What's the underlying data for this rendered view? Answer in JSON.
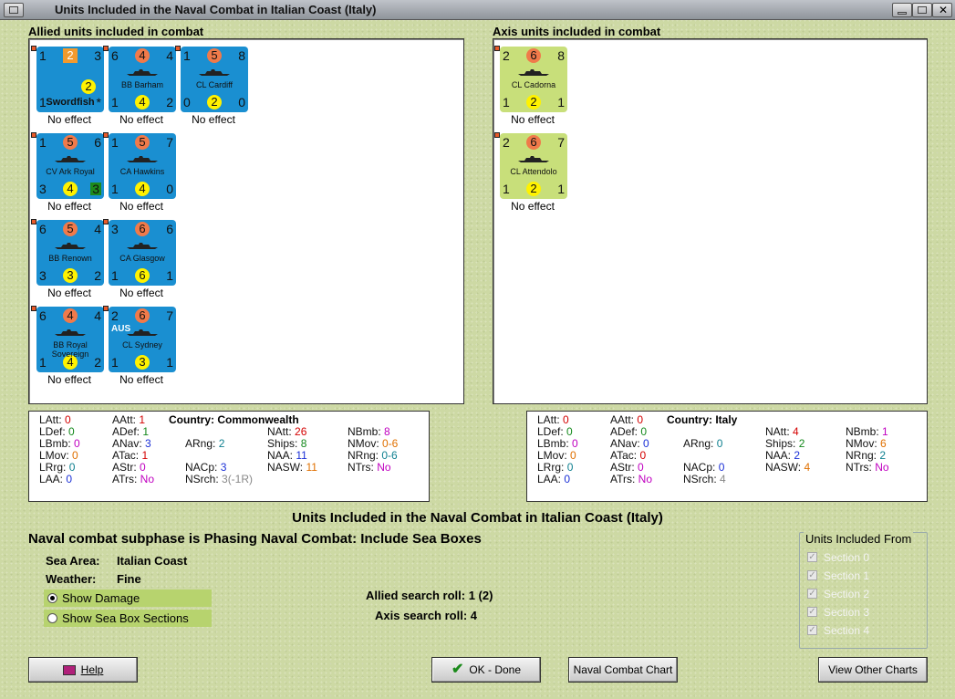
{
  "window": {
    "title": "Units Included in the Naval Combat in Italian Coast (Italy)"
  },
  "allied": {
    "header": "Allied units included in combat"
  },
  "axis": {
    "header": "Axis units included in combat"
  },
  "units_allied": [
    {
      "tl": "1",
      "tr": "3",
      "orange": "2",
      "bl": "1",
      "br": "*",
      "yellow": "2",
      "name": "Swordfish",
      "status": "No effect"
    },
    {
      "tl": "6",
      "tr": "4",
      "orange": "4",
      "bl": "1",
      "br": "2",
      "yellow": "4",
      "name": "BB Barham",
      "status": "No effect"
    },
    {
      "tl": "1",
      "tr": "8",
      "orange": "5",
      "bl": "0",
      "br": "0",
      "yellow": "2",
      "name": "CL Cardiff",
      "status": "No effect"
    },
    {
      "tl": "1",
      "tr": "6",
      "orange": "5",
      "bl": "3",
      "br": "3",
      "yellow": "4",
      "name": "CV Ark Royal",
      "status": "No effect"
    },
    {
      "tl": "1",
      "tr": "7",
      "orange": "5",
      "bl": "1",
      "br": "0",
      "yellow": "4",
      "name": "CA Hawkins",
      "status": "No effect"
    },
    {
      "tl": "6",
      "tr": "4",
      "orange": "5",
      "bl": "3",
      "br": "2",
      "yellow": "3",
      "name": "BB Renown",
      "status": "No effect"
    },
    {
      "tl": "3",
      "tr": "6",
      "orange": "6",
      "bl": "1",
      "br": "1",
      "yellow": "6",
      "name": "CA Glasgow",
      "status": "No effect"
    },
    {
      "tl": "6",
      "tr": "4",
      "orange": "4",
      "bl": "1",
      "br": "2",
      "yellow": "4",
      "name": "BB Royal Sovereign",
      "status": "No effect"
    },
    {
      "tl": "2",
      "tr": "7",
      "orange": "6",
      "bl": "1",
      "br": "1",
      "yellow": "3",
      "name": "CL Sydney",
      "status": "No effect",
      "tag": "AUS"
    }
  ],
  "units_axis": [
    {
      "tl": "2",
      "tr": "8",
      "orange": "6",
      "bl": "1",
      "br": "1",
      "yellow": "2",
      "name": "CL Cadorna",
      "status": "No effect"
    },
    {
      "tl": "2",
      "tr": "7",
      "orange": "6",
      "bl": "1",
      "br": "1",
      "yellow": "2",
      "name": "CL Attendolo",
      "status": "No effect"
    }
  ],
  "stats_allied": {
    "country_label": "Country: Commonwealth",
    "LAtt": "0",
    "LDef": "0",
    "LBmb": "0",
    "LMov": "0",
    "LRrg": "0",
    "LAA": "0",
    "AAtt": "1",
    "ADef": "1",
    "ANav": "3",
    "ATac": "1",
    "AStr": "0",
    "ATrs": "No",
    "ARng": "2",
    "NACp": "3",
    "NSrch": "3(-1R)",
    "NAtt": "26",
    "Ships": "8",
    "NAA": "11",
    "NASW": "11",
    "NBmb": "8",
    "NMov": "0-6",
    "NRng": "0-6",
    "NTrs": "No"
  },
  "stats_axis": {
    "country_label": "Country: Italy",
    "LAtt": "0",
    "LDef": "0",
    "LBmb": "0",
    "LMov": "0",
    "LRrg": "0",
    "LAA": "0",
    "AAtt": "0",
    "ADef": "0",
    "ANav": "0",
    "ATac": "0",
    "AStr": "0",
    "ATrs": "No",
    "ARng": "0",
    "NACp": "0",
    "NSrch": "4",
    "NAtt": "4",
    "Ships": "2",
    "NAA": "2",
    "NASW": "4",
    "NBmb": "1",
    "NMov": "6",
    "NRng": "2",
    "NTrs": "No"
  },
  "summary": {
    "title": "Units Included in the Naval Combat in Italian Coast (Italy)",
    "subphase": "Naval combat subphase is Phasing Naval Combat: Include Sea Boxes",
    "sea_area_label": "Sea Area:",
    "sea_area": "Italian Coast",
    "weather_label": "Weather:",
    "weather": "Fine",
    "allied_roll": "Allied search roll: 1 (2)",
    "axis_roll": "Axis search roll: 4"
  },
  "options": {
    "show_damage": "Show Damage",
    "show_sections": "Show Sea Box Sections"
  },
  "sections": {
    "legend": "Units Included From",
    "items": [
      "Section 0",
      "Section 1",
      "Section 2",
      "Section 3",
      "Section 4"
    ]
  },
  "buttons": {
    "help": "Help",
    "ok": "OK - Done",
    "naval_chart": "Naval Combat Chart",
    "other_charts": "View Other Charts"
  }
}
